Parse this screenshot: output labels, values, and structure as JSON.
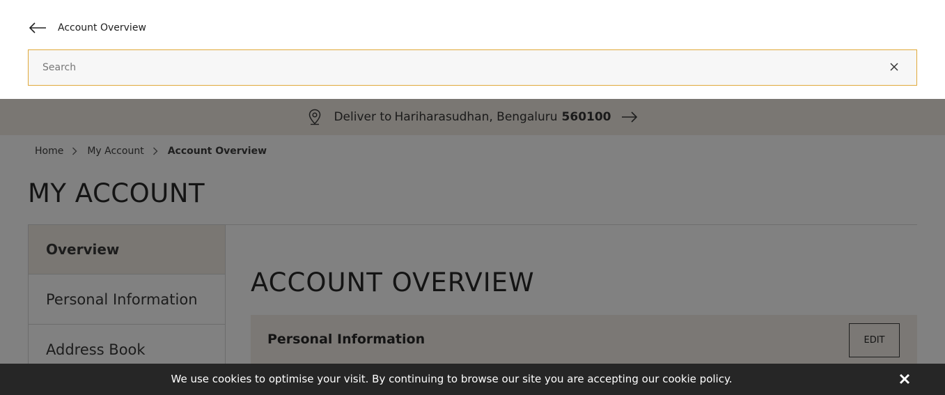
{
  "header": {
    "back_icon": "arrow-left-icon",
    "title": "Account Overview"
  },
  "search": {
    "placeholder": "Search",
    "value": "",
    "clear_icon": "close-icon",
    "border_color": "#e0a93a"
  },
  "delivery": {
    "icon": "location-pin-icon",
    "prefix": "Deliver to",
    "name_city": "Hariharasudhan, Bengaluru",
    "pincode": "560100",
    "arrow_icon": "arrow-right-icon"
  },
  "breadcrumb": {
    "items": [
      "Home",
      "My Account",
      "Account Overview"
    ],
    "separator_icon": "chevron-right-icon"
  },
  "page": {
    "title": "MY ACCOUNT",
    "main_title": "ACCOUNT OVERVIEW"
  },
  "sidebar": {
    "items": [
      {
        "label": "Overview",
        "active": true
      },
      {
        "label": "Personal Information",
        "active": false
      },
      {
        "label": "Address Book",
        "active": false
      }
    ]
  },
  "personal_info_card": {
    "title": "Personal Information",
    "edit_label": "EDIT"
  },
  "cookie_banner": {
    "text": "We use cookies to optimise your visit. By continuing to browse our site you are accepting our cookie policy.",
    "close_icon": "close-icon"
  }
}
